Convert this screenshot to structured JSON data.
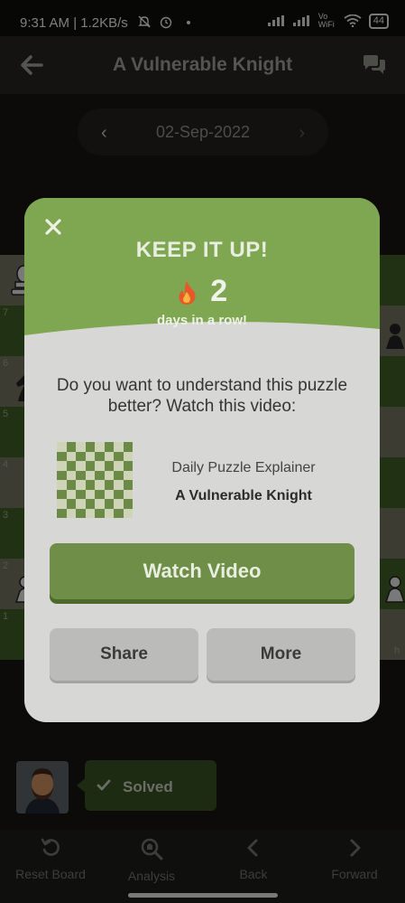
{
  "status_bar": {
    "time_speed": "9:31 AM | 1.2KB/s",
    "dot": "•",
    "vowifi": "Vo WiFi",
    "battery": "44"
  },
  "header": {
    "title": "A Vulnerable Knight"
  },
  "date_nav": {
    "date": "02-Sep-2022",
    "prev": "‹",
    "next": "›"
  },
  "board": {
    "rank_labels": [
      "7",
      "6",
      "5",
      "4",
      "3",
      "2",
      "1"
    ],
    "file_label_h": "h"
  },
  "modal": {
    "headline": "KEEP IT UP!",
    "streak_count": "2",
    "streak_sub": "days in a row!",
    "question": "Do you want to understand this puzzle better? Watch this video:",
    "explainer_label": "Daily Puzzle Explainer",
    "explainer_title": "A Vulnerable Knight",
    "watch_button": "Watch Video",
    "share_button": "Share",
    "more_button": "More"
  },
  "solved_badge": {
    "label": "Solved"
  },
  "bottom_nav": {
    "items": [
      {
        "label": "Reset Board"
      },
      {
        "label": "Analysis"
      },
      {
        "label": "Back"
      },
      {
        "label": "Forward"
      }
    ]
  },
  "colors": {
    "accent_green": "#7fa650",
    "modal_bg": "#d7d7d6",
    "button_grey": "#bbbbba"
  }
}
